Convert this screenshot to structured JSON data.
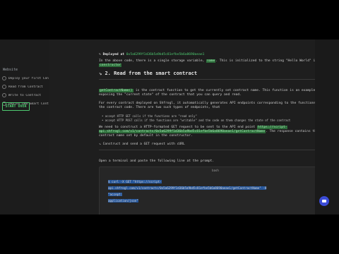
{
  "sidebar": {
    "title": "Website",
    "steps": [
      {
        "label": "Deploy your first Contract"
      },
      {
        "label": "Read from Contract"
      },
      {
        "label": "Write to Contract"
      },
      {
        "label": "Deploy new Smart Contract"
      }
    ],
    "start_button": "START OVER"
  },
  "content": {
    "deployed_label": "Deployed at",
    "deployed_address": "0x5a6299f1d36b5a9bd5c81efbe5b6a8690aeae1",
    "intro_1": "In the above code, there is a single storage variable,",
    "intro_var": "name",
    "intro_2": ". This is initialized to the string \"Hello World\" in the",
    "intro_ctor": "constructor",
    "section_heading": "2. Read from the smart contract",
    "func_name": "getContractName()",
    "func_desc": "is the contract function to get the currently set contract name. This function is an example of exposing the \"current state\" of the contract that you can query and read.",
    "every_contract": "For every contract deployed on Shfrogl, it automatically generates API endpoints corresponding to the functions in the contract code. There are two such types of endpoints, that",
    "bullet_1": "accept HTTP GET calls if the functions are \"read only\"",
    "bullet_2": "accept HTTP POST calls if the functions are \"writable\" and the code on them changes the state of the contract",
    "need_1": "We need to construct a HTTP-formated GET request to be sent to the API end point",
    "endpoint": "https://script-api.shfrogl.com/v1/contracts/0x5a6299f1d36b5a9bd5c81efbe5b6a8690aeae1/getContractName",
    "need_2": ". The response contains the contract name set by default in the constructor.",
    "note": "Construct and send a GET request with cURL",
    "open_terminal": "Open a terminal and paste the following line at the prompt.",
    "terminal_title": "bash",
    "terminal_lines": [
      "curl -X GET \"https://script-",
      "api.shfrogl.com/v1/contracts/0x5a6299f1d36b5a9bd5c81efbe5b6a8690aeae1/getContractName\" -H \"accept:",
      "application/json\""
    ]
  },
  "colors": {
    "accent": "#4ecb71",
    "highlight_bg": "#2d6b3a",
    "chat_bubble": "#3a4bd6"
  }
}
